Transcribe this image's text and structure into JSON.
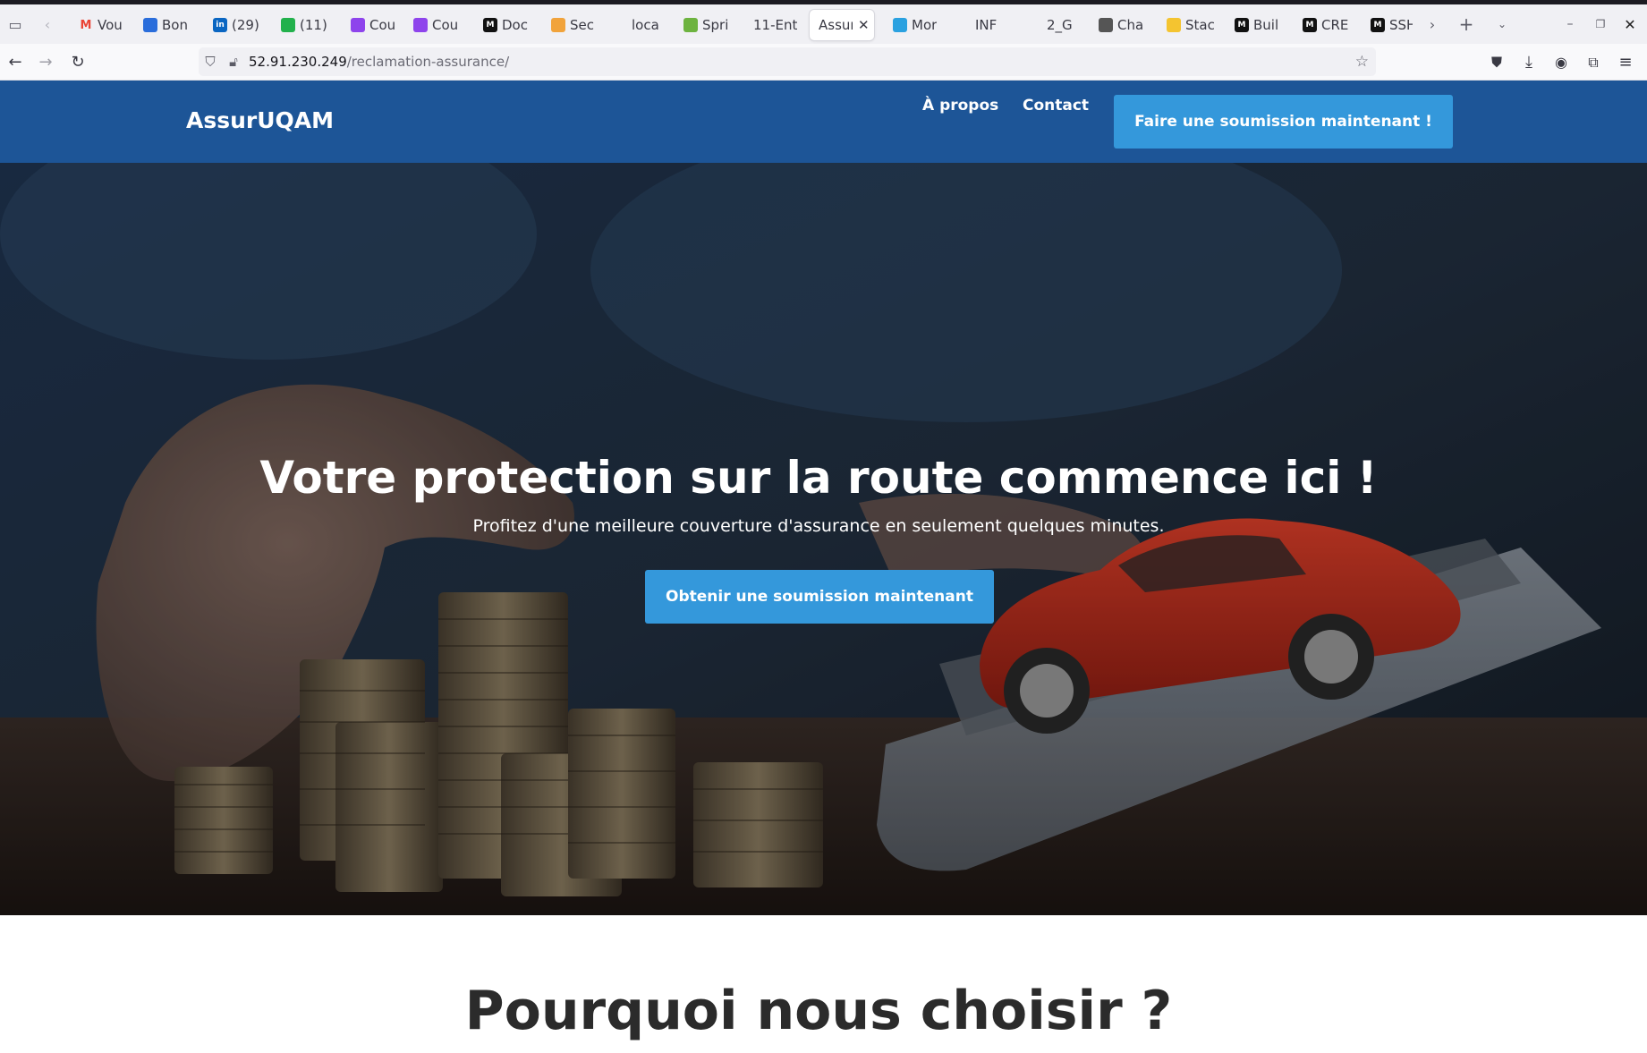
{
  "browser": {
    "tabs": [
      {
        "title": "Vou",
        "icon": "gmail-icon",
        "color": "#ea4335"
      },
      {
        "title": "Bon",
        "icon": "bonjour-icon",
        "color": "#2a6ddb"
      },
      {
        "title": "(29)",
        "icon": "linkedin-icon",
        "color": "#0a66c2"
      },
      {
        "title": "(11)",
        "icon": "chat-icon",
        "color": "#22b14c"
      },
      {
        "title": "Cou",
        "icon": "course-icon",
        "color": "#8e44ec"
      },
      {
        "title": "Cou",
        "icon": "course-icon",
        "color": "#8e44ec"
      },
      {
        "title": "Doc",
        "icon": "medium-icon",
        "color": "#111111"
      },
      {
        "title": "Sec",
        "icon": "box-icon",
        "color": "#f1a33b"
      },
      {
        "title": "loca",
        "icon": "",
        "color": ""
      },
      {
        "title": "Spri",
        "icon": "spring-icon",
        "color": "#6db33f"
      },
      {
        "title": "11-Ent",
        "icon": "",
        "color": ""
      },
      {
        "title": "Assur",
        "icon": "",
        "color": "",
        "active": true
      },
      {
        "title": "Mor",
        "icon": "vscode-icon",
        "color": "#2aa1e0"
      },
      {
        "title": "INF",
        "icon": "",
        "color": ""
      },
      {
        "title": "2_G",
        "icon": "",
        "color": ""
      },
      {
        "title": "Cha",
        "icon": "openai-icon",
        "color": "#555555"
      },
      {
        "title": "Stac",
        "icon": "stack-icon",
        "color": "#f4c430"
      },
      {
        "title": "Buil",
        "icon": "medium-icon",
        "color": "#111111"
      },
      {
        "title": "CRE",
        "icon": "medium-icon",
        "color": "#111111"
      },
      {
        "title": "SSH",
        "icon": "medium-icon",
        "color": "#111111"
      }
    ],
    "url_host": "52.91.230.249",
    "url_path": "/reclamation-assurance/"
  },
  "site": {
    "brand": "AssurUQAM",
    "nav": {
      "about": "À propos",
      "contact": "Contact"
    },
    "cta_top": "Faire une soumission maintenant !",
    "colors": {
      "header": "#1d5597",
      "button": "#3498db"
    }
  },
  "hero": {
    "title": "Votre protection sur la route commence ici !",
    "subtitle": "Profitez d'une meilleure couverture d'assurance en seulement quelques minutes.",
    "cta": "Obtenir une soumission maintenant"
  },
  "section": {
    "why_title": "Pourquoi nous choisir ?"
  }
}
